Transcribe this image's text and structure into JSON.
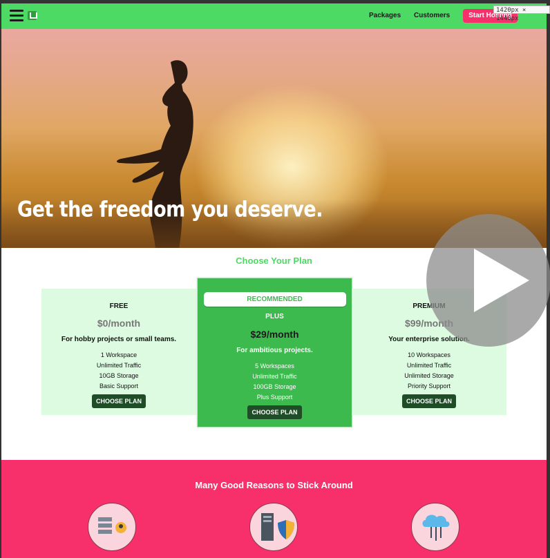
{
  "devtools": {
    "dimensions": "1420px × 1440px"
  },
  "header": {
    "nav": [
      "Packages",
      "Customers"
    ],
    "cta": "Start Hosting"
  },
  "hero": {
    "title": "Get the freedom you deserve."
  },
  "plans": {
    "section_title": "Choose Your Plan",
    "free": {
      "name": "FREE",
      "price": "$0/month",
      "desc": "For hobby projects or small teams.",
      "features": [
        "1 Workspace",
        "Unlimited Traffic",
        "10GB Storage",
        "Basic Support"
      ],
      "button": "CHOOSE PLAN"
    },
    "plus": {
      "badge": "RECOMMENDED",
      "name": "PLUS",
      "price": "$29/month",
      "desc": "For ambitious projects.",
      "features": [
        "5 Workspaces",
        "Unlimited Traffic",
        "100GB Storage",
        "Plus Support"
      ],
      "button": "CHOOSE PLAN"
    },
    "premium": {
      "name": "PREMIUM",
      "price": "$99/month",
      "desc": "Your enterprise solution.",
      "features": [
        "10 Workspaces",
        "Unlimited Traffic",
        "Unlimited Storage",
        "Priority Support"
      ],
      "button": "CHOOSE PLAN"
    }
  },
  "reasons": {
    "title": "Many Good Reasons to Stick Around",
    "icons": [
      "server-user-icon",
      "server-shield-icon",
      "cloud-network-icon"
    ]
  },
  "colors": {
    "header_green": "#4cd964",
    "accent_pink": "#f7306b",
    "plan_light": "#dcfbe0",
    "plan_recommended": "#3dba4e",
    "button_dark_green": "#1f4d27"
  }
}
